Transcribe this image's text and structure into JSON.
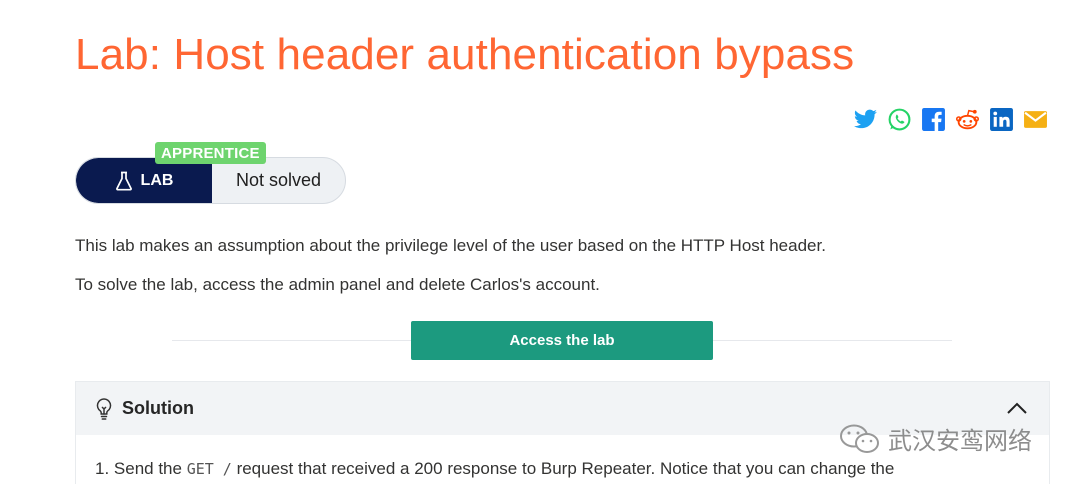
{
  "page": {
    "title": "Lab: Host header authentication bypass"
  },
  "share": {
    "icons": [
      "twitter-icon",
      "whatsapp-icon",
      "facebook-icon",
      "reddit-icon",
      "linkedin-icon",
      "email-icon"
    ],
    "colors": {
      "twitter": "#1da1f2",
      "whatsapp": "#25d366",
      "facebook": "#1877f2",
      "reddit": "#ff4500",
      "linkedin": "#0a66c2",
      "email": "#f5b014"
    }
  },
  "lab": {
    "level": "APPRENTICE",
    "type_label": "LAB",
    "status": "Not solved"
  },
  "description": {
    "line1": "This lab makes an assumption about the privilege level of the user based on the HTTP Host header.",
    "line2": "To solve the lab, access the admin panel and delete Carlos's account."
  },
  "access_button": {
    "label": "Access the lab"
  },
  "solution": {
    "heading": "Solution",
    "step1_prefix": "1. Send the ",
    "step1_code": "GET /",
    "step1_suffix": " request that received a 200 response to Burp Repeater. Notice that you can change the"
  },
  "watermark": {
    "text": "武汉安鸾网络"
  },
  "colors": {
    "title": "#ff6633",
    "level_badge": "#6ed46e",
    "lab_dark": "#0a1a4f",
    "access_button": "#1c9a7f"
  }
}
